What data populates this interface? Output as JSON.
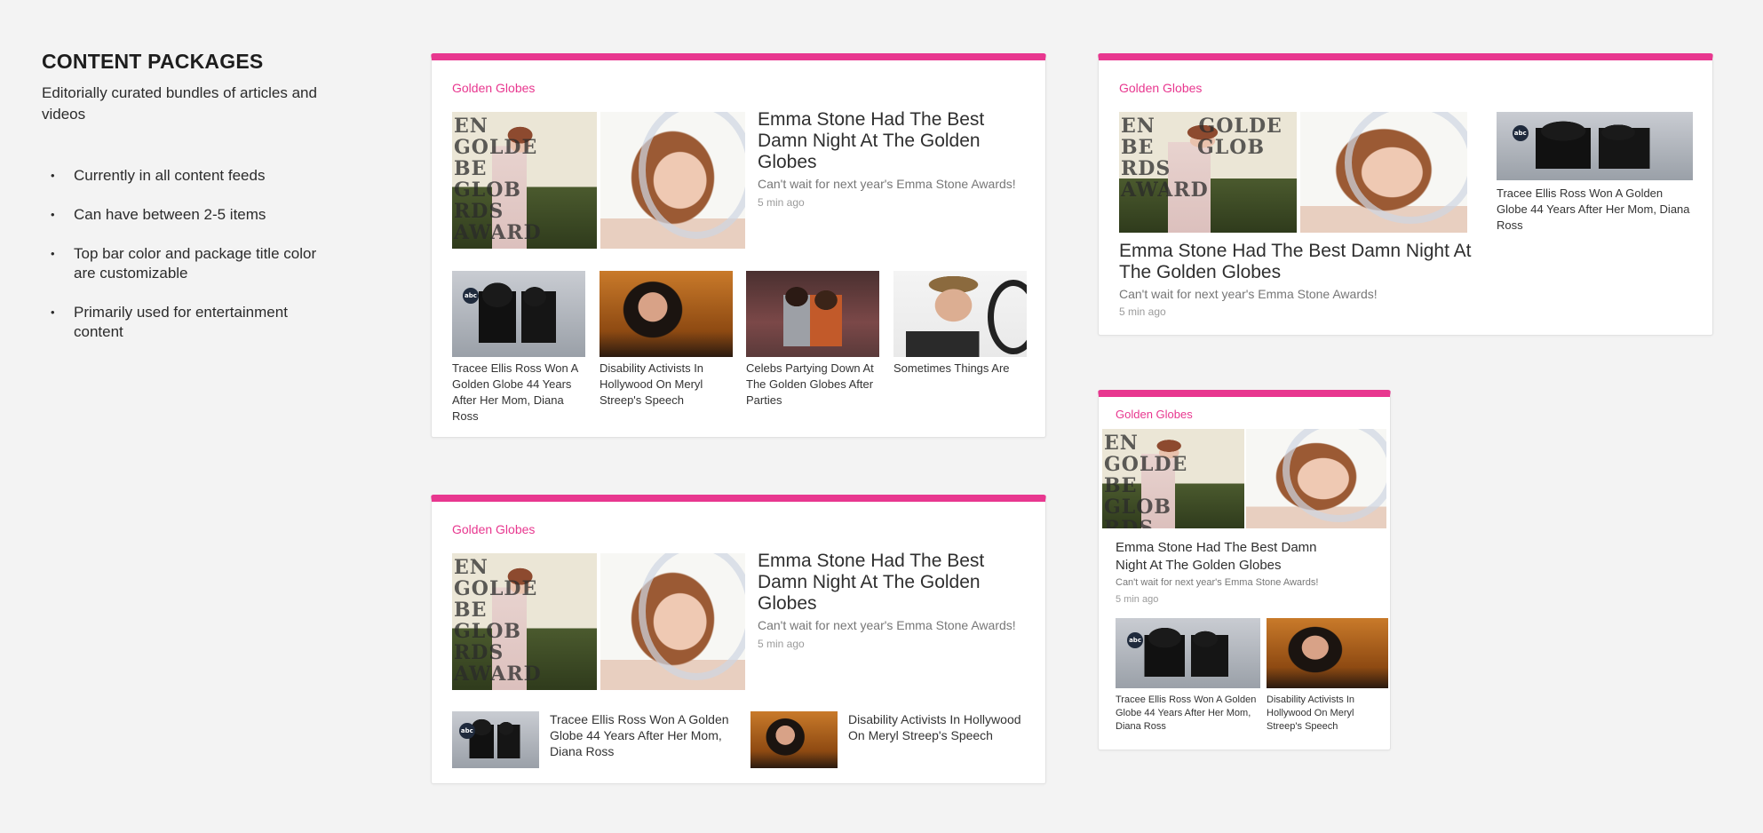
{
  "intro": {
    "title": "CONTENT PACKAGES",
    "subtitle": "Editorially curated bundles of articles and videos",
    "bullets": [
      "Currently in all content feeds",
      "Can have between 2-5 items",
      "Top bar color and package title color are customizable",
      "Primarily used for entertainment content"
    ]
  },
  "package": {
    "title": "Golden Globes",
    "accent_color": "#e8378f",
    "lead": {
      "headline": "Emma Stone Had The Best Damn Night At The Golden Globes",
      "dek": "Can't wait for next year's Emma Stone Awards!",
      "time": "5 min ago"
    },
    "items": [
      "Tracee Ellis Ross Won A Golden Globe 44 Years After Her Mom, Diana Ross",
      "Disability Activists In Hollywood On Meryl Streep's Speech",
      "Celebs Partying Down At The Golden Globes After Parties",
      "Sometimes Things Are"
    ]
  }
}
